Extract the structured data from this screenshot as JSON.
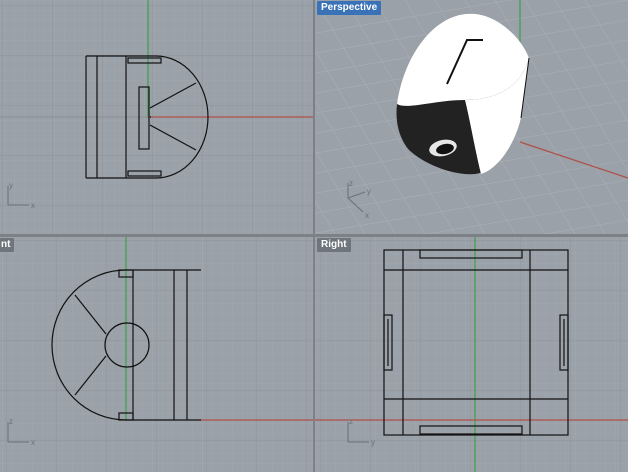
{
  "viewports": {
    "top": {
      "label": ""
    },
    "perspective": {
      "label": "Perspective"
    },
    "front": {
      "label": "nt"
    },
    "right": {
      "label": "Right"
    }
  },
  "axes": {
    "x": "x",
    "y": "y",
    "z": "z"
  },
  "colors": {
    "grid_minor": "#a2a8af",
    "grid_major": "#8f959c",
    "x_axis": "#b0504a",
    "y_axis": "#3f9f4a",
    "model_line": "#111111",
    "active_label": "#3a72b8"
  }
}
